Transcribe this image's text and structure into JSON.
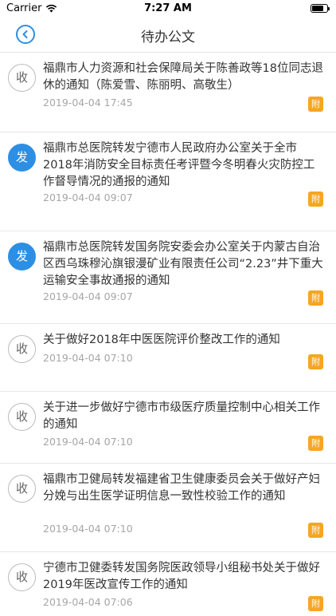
{
  "status_bar": {
    "carrier": "Carrier",
    "time": "7:27 AM",
    "battery_level": 0.8
  },
  "nav": {
    "title": "待办公文"
  },
  "items": [
    {
      "badge": "收",
      "type": "recv",
      "title": "福鼎市人力资源和社会保障局关于陈善政等18位同志退休的通知（陈爱雪、陈丽明、高敬生）",
      "date": "2019-04-04 17:45",
      "attach": "附"
    },
    {
      "badge": "发",
      "type": "send",
      "title": "福鼎市总医院转发宁德市人民政府办公室关于全市2018年消防安全目标责任考评暨今冬明春火灾防控工作督导情况的通报的通知",
      "date": "2019-04-04 09:07",
      "attach": "附"
    },
    {
      "badge": "发",
      "type": "send",
      "title": "福鼎市总医院转发国务院安委会办公室关于内蒙古自治区西乌珠穆沁旗银漫矿业有限责任公司“2.23”井下重大运输安全事故通报的通知",
      "date": "2019-04-04 09:07",
      "attach": "附"
    },
    {
      "badge": "收",
      "type": "recv",
      "title": "关于做好2018年中医医院评价整改工作的通知",
      "date": "2019-04-04 07:10",
      "attach": "附"
    },
    {
      "badge": "收",
      "type": "recv",
      "title": "关于进一步做好宁德市市级医疗质量控制中心相关工作的通知",
      "date": "2019-04-04 07:10",
      "attach": "附"
    },
    {
      "badge": "收",
      "type": "recv",
      "title": "福鼎市卫健局转发福建省卫生健康委员会关于做好产妇分娩与出生医学证明信息一致性校验工作的通知",
      "date": "2019-04-04 07:10",
      "attach": "附"
    },
    {
      "badge": "收",
      "type": "recv",
      "title": "宁德市卫健委转发国务院医政领导小组秘书处关于做好2019年医改宣传工作的通知",
      "date": "2019-04-04 07:06",
      "attach": "附"
    }
  ]
}
